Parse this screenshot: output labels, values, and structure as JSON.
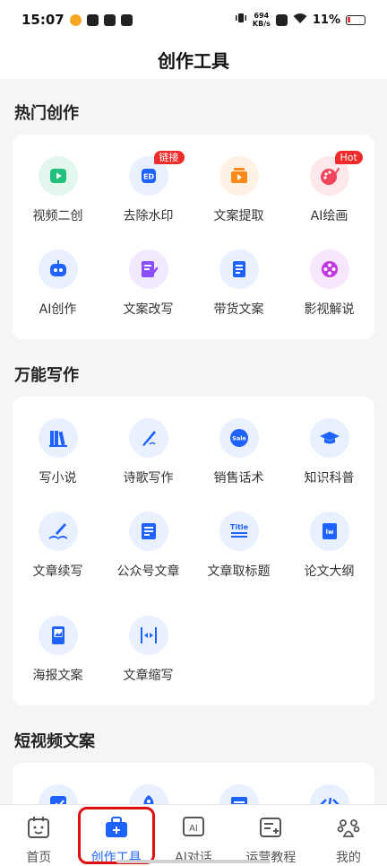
{
  "status": {
    "time": "15:07",
    "net_speed_top": "694",
    "net_speed_bottom": "KB/s",
    "battery": "11%"
  },
  "header": {
    "title": "创作工具"
  },
  "sections": [
    {
      "title": "热门创作",
      "tools": [
        {
          "label": "视频二创",
          "icon": "video-play-icon",
          "color": "#22c07a",
          "bg": "#e3f7ee"
        },
        {
          "label": "去除水印",
          "icon": "watermark-remove-icon",
          "color": "#1e62ff",
          "bg": "#e9f0ff",
          "badge": "链接"
        },
        {
          "label": "文案提取",
          "icon": "video-extract-icon",
          "color": "#ff8a1a",
          "bg": "#fff1e3"
        },
        {
          "label": "AI绘画",
          "icon": "palette-icon",
          "color": "#f0455b",
          "bg": "#fde8eb",
          "badge": "Hot"
        },
        {
          "label": "AI创作",
          "icon": "robot-icon",
          "color": "#1e62ff",
          "bg": "#e9f0ff"
        },
        {
          "label": "文案改写",
          "icon": "edit-doc-icon",
          "color": "#8a4dff",
          "bg": "#f1e9ff"
        },
        {
          "label": "带货文案",
          "icon": "doc-list-icon",
          "color": "#1e62ff",
          "bg": "#e9f0ff"
        },
        {
          "label": "影视解说",
          "icon": "film-reel-icon",
          "color": "#c136e0",
          "bg": "#f7e6fb"
        }
      ]
    },
    {
      "title": "万能写作",
      "tools": [
        {
          "label": "写小说",
          "icon": "books-icon",
          "color": "#1e62ff",
          "bg": "#e9f0ff"
        },
        {
          "label": "诗歌写作",
          "icon": "quill-icon",
          "color": "#1e62ff",
          "bg": "#e9f0ff"
        },
        {
          "label": "销售话术",
          "icon": "sale-badge-icon",
          "color": "#1e62ff",
          "bg": "#e9f0ff"
        },
        {
          "label": "知识科普",
          "icon": "graduation-cap-icon",
          "color": "#1e62ff",
          "bg": "#e9f0ff"
        },
        {
          "label": "文章续写",
          "icon": "open-book-pen-icon",
          "color": "#1e62ff",
          "bg": "#e9f0ff"
        },
        {
          "label": "公众号文章",
          "icon": "article-icon",
          "color": "#1e62ff",
          "bg": "#e9f0ff"
        },
        {
          "label": "文章取标题",
          "icon": "title-text-icon",
          "color": "#1e62ff",
          "bg": "#e9f0ff"
        },
        {
          "label": "论文大纲",
          "icon": "paper-outline-icon",
          "color": "#1e62ff",
          "bg": "#e9f0ff"
        },
        {
          "label": "海报文案",
          "icon": "poster-icon",
          "color": "#1e62ff",
          "bg": "#e9f0ff"
        },
        {
          "label": "文章缩写",
          "icon": "compress-icon",
          "color": "#1e62ff",
          "bg": "#e9f0ff"
        }
      ]
    },
    {
      "title": "短视频文案",
      "tools": [
        {
          "label": "",
          "icon": "chart-icon",
          "color": "#1e62ff",
          "bg": "#e9f0ff"
        },
        {
          "label": "",
          "icon": "rocket-icon",
          "color": "#1e62ff",
          "bg": "#e9f0ff"
        },
        {
          "label": "",
          "icon": "browser-icon",
          "color": "#1e62ff",
          "bg": "#e9f0ff"
        },
        {
          "label": "",
          "icon": "code-icon",
          "color": "#1e62ff",
          "bg": "#e9f0ff"
        }
      ]
    }
  ],
  "tabs": [
    {
      "label": "首页",
      "icon": "home-calendar-icon",
      "active": false
    },
    {
      "label": "创作工具",
      "icon": "toolbox-icon",
      "active": true
    },
    {
      "label": "AI对话",
      "icon": "ai-chat-icon",
      "active": false
    },
    {
      "label": "运营教程",
      "icon": "tutorial-icon",
      "active": false
    },
    {
      "label": "我的",
      "icon": "paw-profile-icon",
      "active": false
    }
  ],
  "colors": {
    "accent": "#1e62ff",
    "highlight": "#e01010"
  }
}
